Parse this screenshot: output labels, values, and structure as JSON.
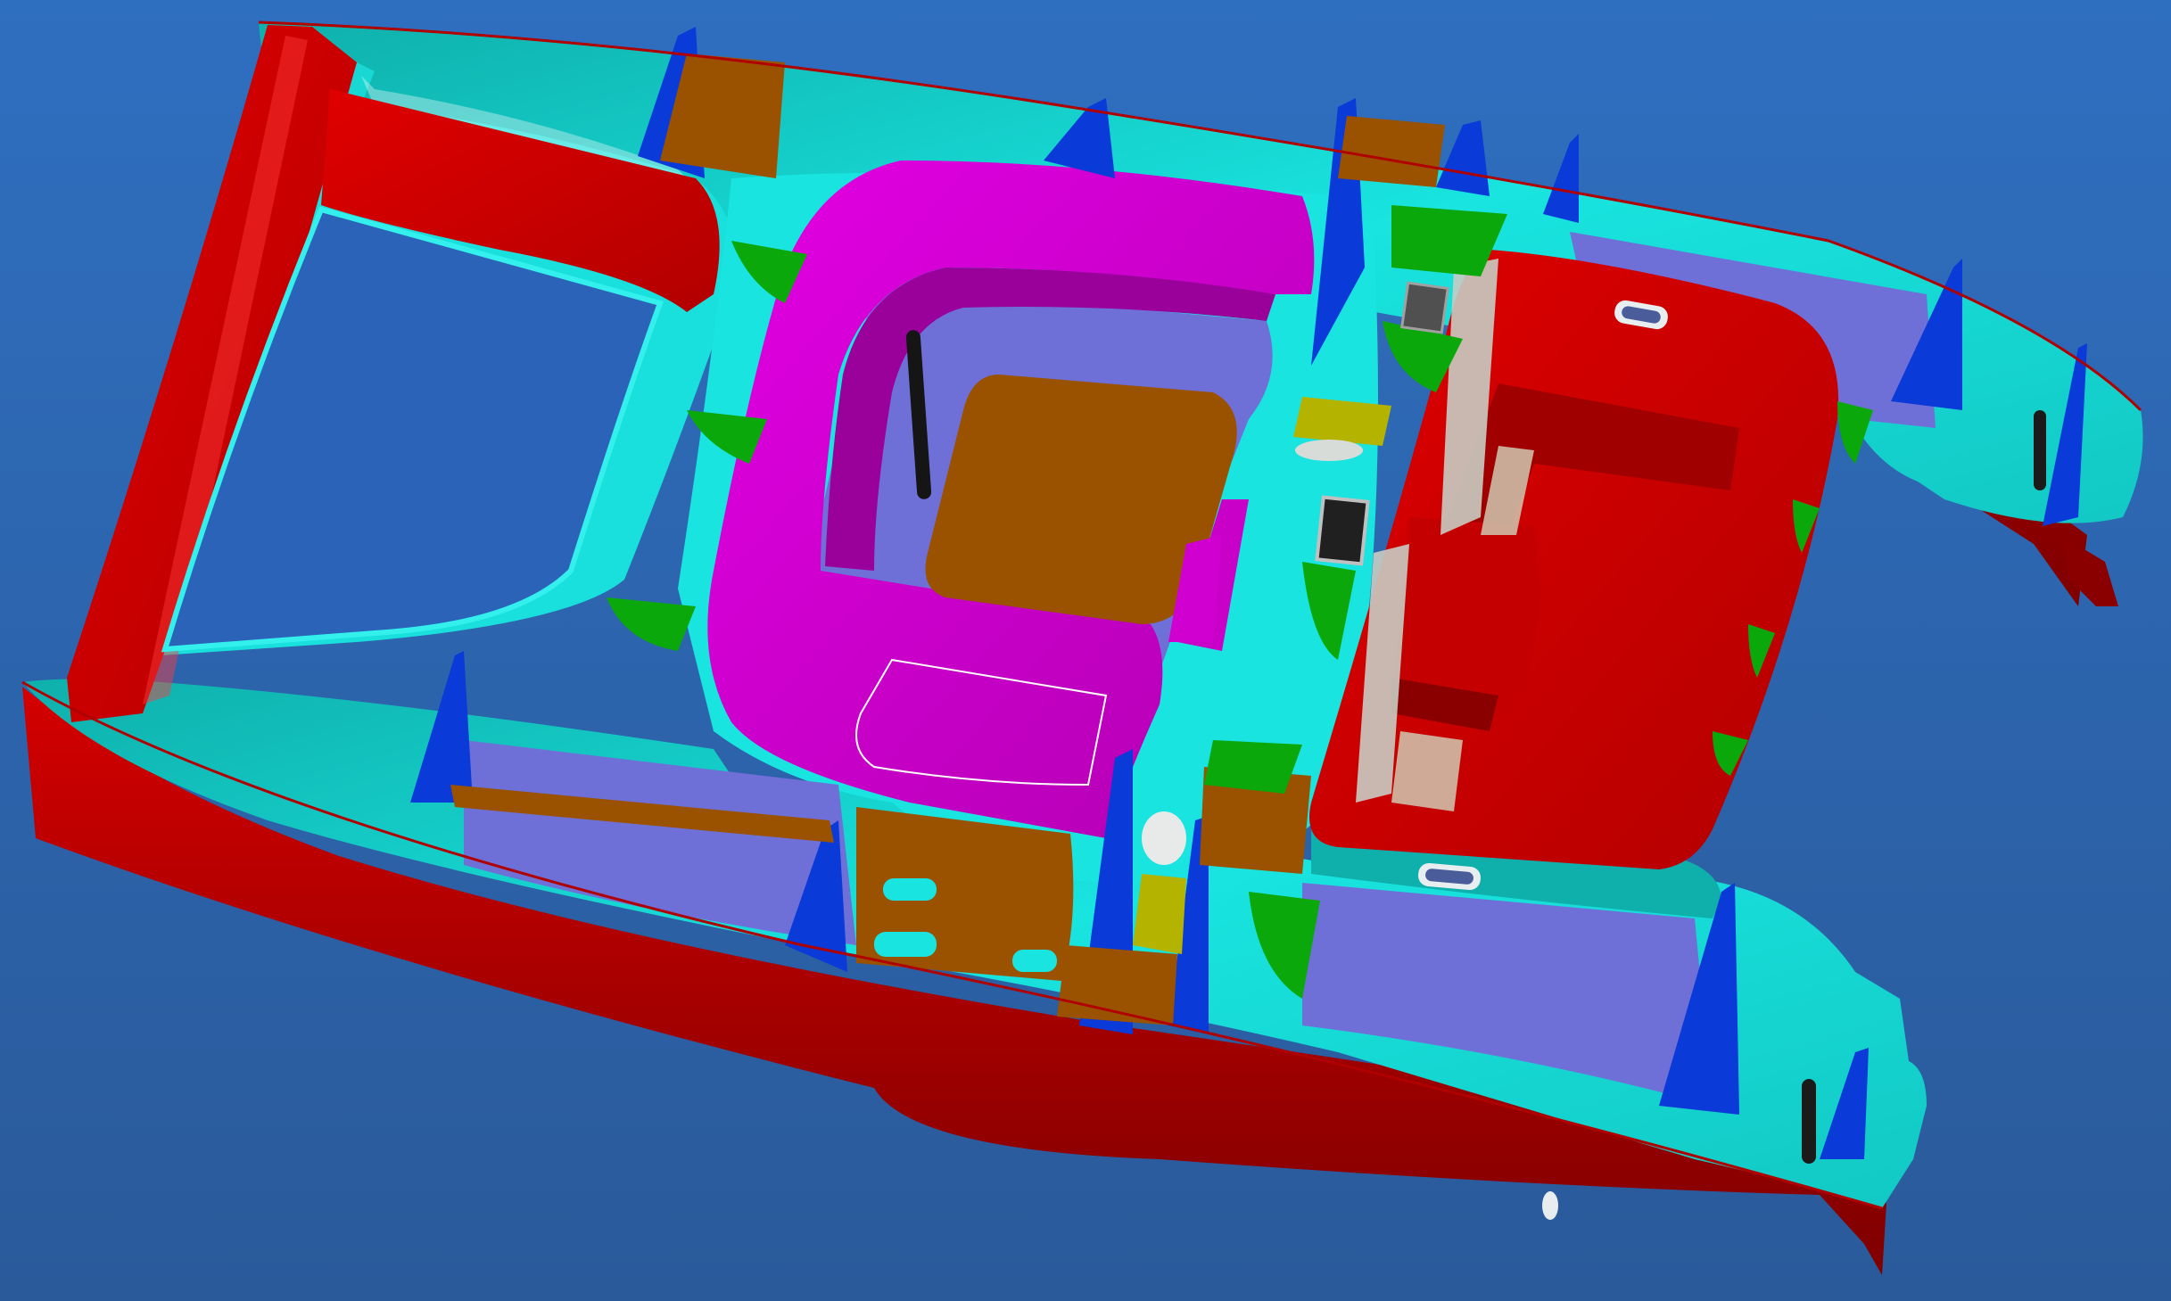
{
  "scene": {
    "description_visible_text": [],
    "colors": {
      "background_top": "#2f6fc0",
      "background_bottom": "#2a5a9a",
      "hull_red": "#c80000",
      "hull_red_dark": "#8e0000",
      "deck_cyan": "#19e0dc",
      "deck_cyan_dark": "#0fa7a3",
      "floor_lavender": "#6f6fd8",
      "bulkhead_blue": "#0a3ad8",
      "cockpit_magenta": "#d400d4",
      "cockpit_magenta_dark": "#9a009a",
      "wood_brown": "#9a5200",
      "frame_green": "#0aa80a",
      "hatch_olive": "#b4b400",
      "window_grey": "#c0c6c0",
      "tiller_black": "#151515",
      "hatch_white": "#e8eef0"
    }
  }
}
